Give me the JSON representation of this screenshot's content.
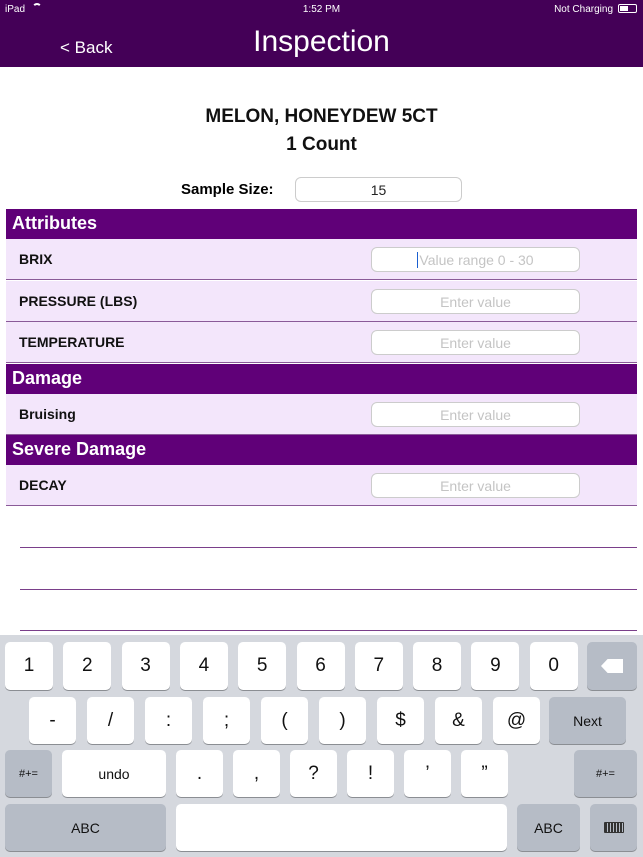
{
  "status_bar": {
    "device": "iPad",
    "time": "1:52 PM",
    "battery": "Not Charging"
  },
  "nav": {
    "back": "< Back",
    "title": "Inspection"
  },
  "product": {
    "name": "MELON, HONEYDEW 5CT",
    "count": "1 Count"
  },
  "sample": {
    "label": "Sample Size:",
    "value": "15"
  },
  "sections": [
    {
      "title": "Attributes",
      "rows": [
        {
          "label": "BRIX",
          "placeholder": "Value range 0 - 30"
        },
        {
          "label": "PRESSURE (LBS)",
          "placeholder": "Enter value"
        },
        {
          "label": "TEMPERATURE",
          "placeholder": "Enter value"
        }
      ]
    },
    {
      "title": "Damage",
      "rows": [
        {
          "label": "Bruising",
          "placeholder": "Enter value"
        }
      ]
    },
    {
      "title": "Severe Damage",
      "rows": [
        {
          "label": "DECAY",
          "placeholder": "Enter value"
        }
      ]
    }
  ],
  "keyboard": {
    "row1": [
      "1",
      "2",
      "3",
      "4",
      "5",
      "6",
      "7",
      "8",
      "9",
      "0"
    ],
    "delete_icon": "backspace-icon",
    "row2": [
      "-",
      "/",
      ":",
      ";",
      "(",
      ")",
      "$",
      "&",
      "@"
    ],
    "next": "Next",
    "row3": [
      ".",
      ",",
      "?",
      "!",
      "’",
      "”"
    ],
    "symbols": "#+=",
    "undo": "undo",
    "abc": "ABC",
    "hide_icon": "keyboard-hide-icon"
  },
  "colors": {
    "nav": "#440057",
    "section": "#600078",
    "row": "#f3e6fb"
  }
}
